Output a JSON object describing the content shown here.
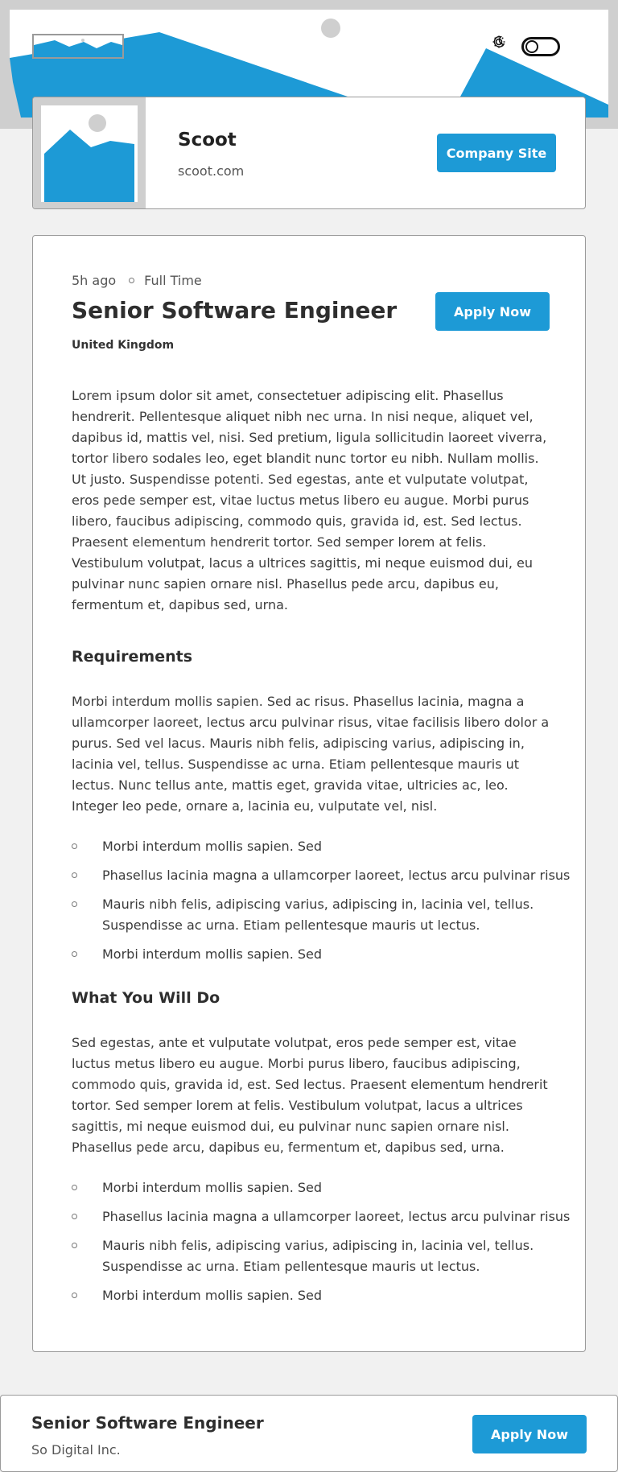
{
  "header": {
    "logo_icon": "image-placeholder-icon",
    "theme": {
      "light_icon": "sun-icon",
      "dark_icon": "moon-icon"
    }
  },
  "company": {
    "name": "Scoot",
    "website": "scoot.com",
    "button_label": "Company Site"
  },
  "job": {
    "posted": "5h ago",
    "type": "Full Time",
    "title": "Senior Software Engineer",
    "location": "United Kingdom",
    "apply_label": "Apply Now",
    "description": "Lorem ipsum dolor sit amet, consectetuer adipiscing elit. Phasellus hendrerit. Pellentesque aliquet nibh nec urna. In nisi neque, aliquet vel, dapibus id, mattis vel, nisi. Sed pretium, ligula sollicitudin laoreet viverra, tortor libero sodales leo, eget blandit nunc tortor eu nibh. Nullam mollis. Ut justo. Suspendisse potenti. Sed egestas, ante et vulputate volutpat, eros pede semper est, vitae luctus metus libero eu augue. Morbi purus libero, faucibus adipiscing, commodo quis, gravida id, est. Sed lectus. Praesent elementum hendrerit tortor. Sed semper lorem at felis. Vestibulum volutpat, lacus a ultrices sagittis, mi neque euismod dui, eu pulvinar nunc sapien ornare nisl. Phasellus pede arcu, dapibus eu, fermentum et, dapibus sed, urna.",
    "requirements": {
      "title": "Requirements",
      "text": "Morbi interdum mollis sapien. Sed ac risus. Phasellus lacinia, magna a ullamcorper laoreet, lectus arcu pulvinar risus, vitae facilisis libero dolor a purus. Sed vel lacus. Mauris nibh felis, adipiscing varius, adipiscing in, lacinia vel, tellus. Suspendisse ac urna. Etiam pellentesque mauris ut lectus. Nunc tellus ante, mattis eget, gravida vitae, ultricies ac, leo. Integer leo pede, ornare a, lacinia eu, vulputate vel, nisl.",
      "items": [
        "Morbi interdum mollis sapien. Sed",
        "Phasellus lacinia magna a ullamcorper laoreet, lectus arcu pulvinar risus",
        "Mauris nibh felis, adipiscing varius, adipiscing in, lacinia vel, tellus.",
        "Suspendisse ac urna. Etiam pellentesque mauris ut lectus.",
        "Morbi interdum mollis sapien. Sed"
      ]
    },
    "role": {
      "title": "What You Will Do",
      "text": "Sed egestas, ante et vulputate volutpat, eros pede semper est, vitae luctus metus libero eu augue. Morbi purus libero, faucibus adipiscing, commodo quis, gravida id, est. Sed lectus. Praesent elementum hendrerit tortor. Sed semper lorem at felis. Vestibulum volutpat, lacus a ultrices sagittis, mi neque euismod dui, eu pulvinar nunc sapien ornare nisl. Phasellus pede arcu, dapibus eu, fermentum et, dapibus sed, urna.",
      "items": [
        "Morbi interdum mollis sapien. Sed",
        "Phasellus lacinia magna a ullamcorper laoreet, lectus arcu pulvinar risus",
        "Mauris nibh felis, adipiscing varius, adipiscing in, lacinia vel, tellus.",
        "Suspendisse ac urna. Etiam pellentesque mauris ut lectus.",
        "Morbi interdum mollis sapien. Sed"
      ]
    }
  },
  "footer": {
    "title": "Senior Software Engineer",
    "company": "So Digital Inc.",
    "apply_label": "Apply Now"
  },
  "colors": {
    "accent": "#1d9ad6",
    "background": "#f1f1f1",
    "placeholder_gray": "#cfcfcf"
  }
}
